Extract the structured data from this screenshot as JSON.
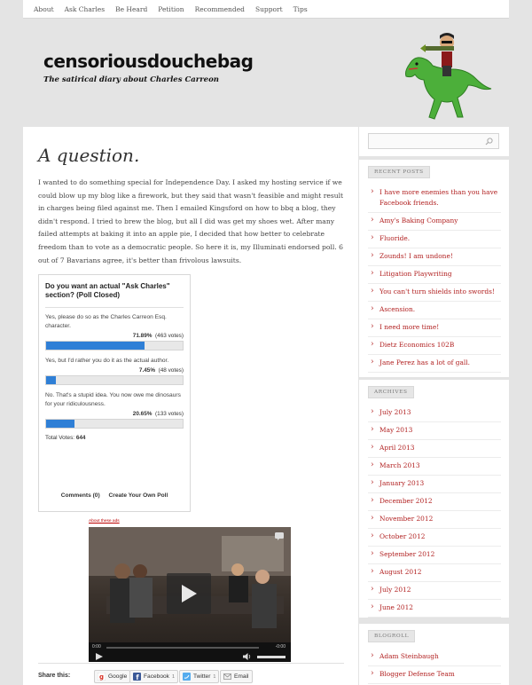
{
  "nav": [
    "About",
    "Ask Charles",
    "Be Heard",
    "Petition",
    "Recommended",
    "Support",
    "Tips"
  ],
  "site": {
    "title": "censoriousdouchebag",
    "tagline": "The satirical diary about Charles Carreon"
  },
  "post": {
    "title": "A question.",
    "body": "I wanted to do something special for Independence Day. I asked my hosting service if we could blow up my blog like a firework, but they said that wasn't feasible and might result in charges being filed against me. Then I emailed Kingsford on how to bbq a blog, they didn't respond. I tried to brew the blog, but all I did was get my shoes wet. After many failed attempts at baking it into an apple pie, I decided that how better to celebrate freedom than to vote as a democratic people. So here it is, my Illuminati endorsed poll. 6 out of 7 Bavarians agree, it's better than frivolous lawsuits."
  },
  "poll": {
    "question": "Do you want an actual \"Ask Charles\" section? (Poll Closed)",
    "answers": [
      {
        "text": "Yes, please do so as the Charles Carreon Esq. character.",
        "percent": "71.89%",
        "votes": "(463 votes)",
        "fraction": 0.7189
      },
      {
        "text": "Yes, but I'd rather you do it as the actual author.",
        "percent": "7.45%",
        "votes": "(48 votes)",
        "fraction": 0.0745
      },
      {
        "text": "No. That's a stupid idea. You now owe me dinosaurs for your ridiculousness.",
        "percent": "20.65%",
        "votes": "(133 votes)",
        "fraction": 0.2065
      }
    ],
    "total_label": "Total Votes:",
    "total": "644",
    "comments_link": "Comments (0)",
    "create_link": "Create Your Own Poll"
  },
  "ad": {
    "label": "About these ads"
  },
  "video": {
    "time_left": "0:00",
    "time_right": "-0:00"
  },
  "share": {
    "label": "Share this:",
    "google": "Google",
    "facebook": "Facebook",
    "facebook_count": "1",
    "twitter": "Twitter",
    "twitter_count": "1",
    "email": "Email"
  },
  "sidebar": {
    "search_placeholder": "",
    "recent_posts_title": "RECENT POSTS",
    "recent_posts": [
      "I have more enemies than you have Facebook friends.",
      "Amy's Baking Company",
      "Fluoride.",
      "Zounds! I am undone!",
      "Litigation Playwriting",
      "You can't turn shields into swords!",
      "Ascension.",
      "I need more time!",
      "Dietz Economics 102B",
      "Jane Perez has a lot of gall."
    ],
    "archives_title": "ARCHIVES",
    "archives": [
      "July 2013",
      "May 2013",
      "April 2013",
      "March 2013",
      "January 2013",
      "December 2012",
      "November 2012",
      "October 2012",
      "September 2012",
      "August 2012",
      "July 2012",
      "June 2012"
    ],
    "blogroll_title": "BLOGROLL",
    "blogroll": [
      "Adam Steinbaugh",
      "Blogger Defense Team"
    ]
  },
  "colors": {
    "link": "#b22222",
    "poll_bar": "#2f7fd6",
    "background": "#e4e4e4"
  }
}
